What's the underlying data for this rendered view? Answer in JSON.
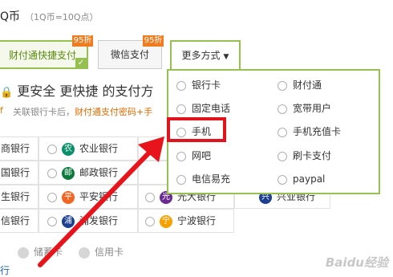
{
  "header": {
    "title": "Q币",
    "rate": "（1Q币=10Q点）"
  },
  "tabs": {
    "tenpay": {
      "label": "财付通快捷支付",
      "discount": "95折"
    },
    "wechat": {
      "label": "微信支付",
      "discount": "95折"
    },
    "more": {
      "label": "更多方式"
    }
  },
  "promo": {
    "headline": "更安全  更快捷  的支付方",
    "sub_prefix": "关联银行卡后，",
    "sub_highlight": "财付通支付密码+手"
  },
  "banks": [
    {
      "name": "商银行",
      "logo_color": "#c8102e"
    },
    {
      "name": "农业银行",
      "logo_color": "#0a8f6a"
    },
    {
      "name": "国银行",
      "logo_color": "#b81c22"
    },
    {
      "name": "邮政银行",
      "logo_color": "#0a7a3b"
    },
    {
      "name": "生银行",
      "logo_color": "#00794a"
    },
    {
      "name": "平安银行",
      "logo_color": "#f26522"
    },
    {
      "name": "光大银行",
      "logo_color": "#6a2c91"
    },
    {
      "name": "兴业银行",
      "logo_color": "#1d3f8f"
    },
    {
      "name": "信银行",
      "logo_color": "#c8102e"
    },
    {
      "name": "浦发银行",
      "logo_color": "#1d3f8f"
    },
    {
      "name": "宁波银行",
      "logo_color": "#f7a100"
    }
  ],
  "card_types": {
    "debit": "储蓄卡",
    "credit": "信用卡"
  },
  "bottom_link": "行",
  "popup": {
    "items": [
      "银行卡",
      "财付通",
      "固定电话",
      "宽带用户",
      "手机",
      "手机充值卡",
      "网吧",
      "刷卡支付",
      "电信易充",
      "paypal"
    ]
  },
  "watermark": "Baidu经验",
  "colors": {
    "accent_green": "#96c04f",
    "badge_orange": "#f07c1f",
    "highlight_red": "#e0141c",
    "arrow_red": "#e8141c"
  }
}
